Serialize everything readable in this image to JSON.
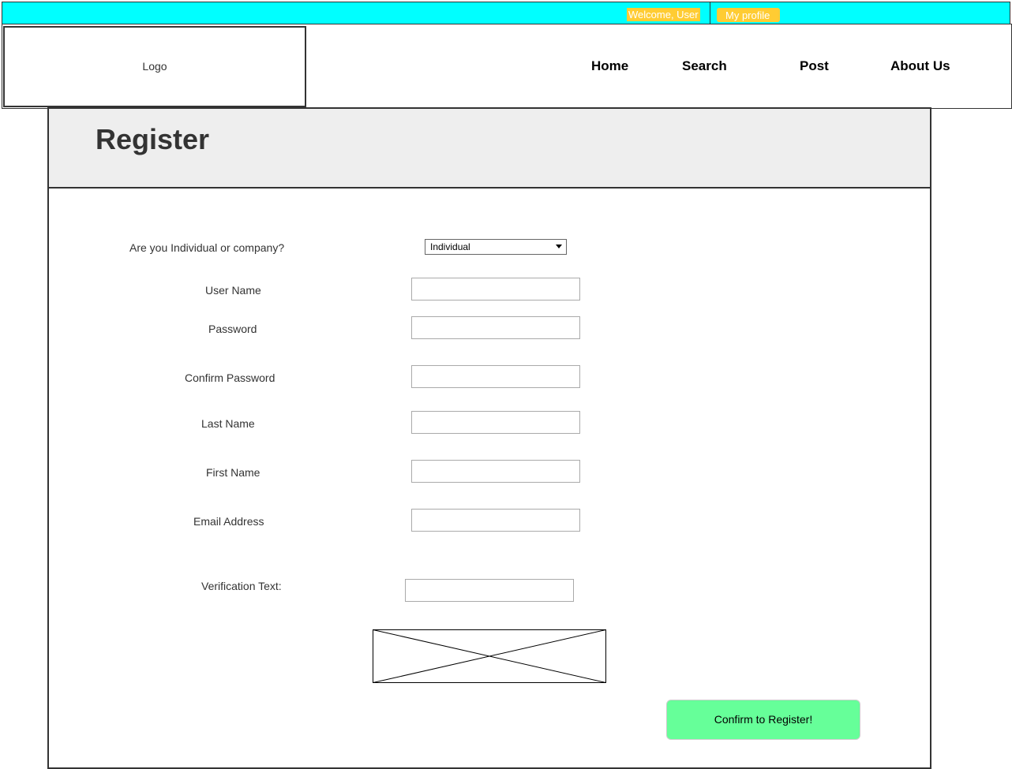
{
  "topbar": {
    "welcome_text": "Welcome, User",
    "profile_label": "My profile",
    "background": "#00ffff",
    "badge_color": "#ffcc33"
  },
  "header": {
    "logo_text": "Logo",
    "nav": {
      "home": "Home",
      "search": "Search",
      "post": "Post",
      "about": "About Us"
    }
  },
  "page": {
    "title": "Register"
  },
  "form": {
    "type_label": "Are you Individual or company?",
    "type_value": "Individual",
    "username_label": "User Name",
    "password_label": "Password",
    "confirm_password_label": "Confirm Password",
    "last_name_label": "Last Name",
    "first_name_label": "First Name",
    "email_label": "Email Address",
    "verification_label": "Verification Text:",
    "submit_label": "Confirm to Register!",
    "submit_color": "#66ff99"
  }
}
